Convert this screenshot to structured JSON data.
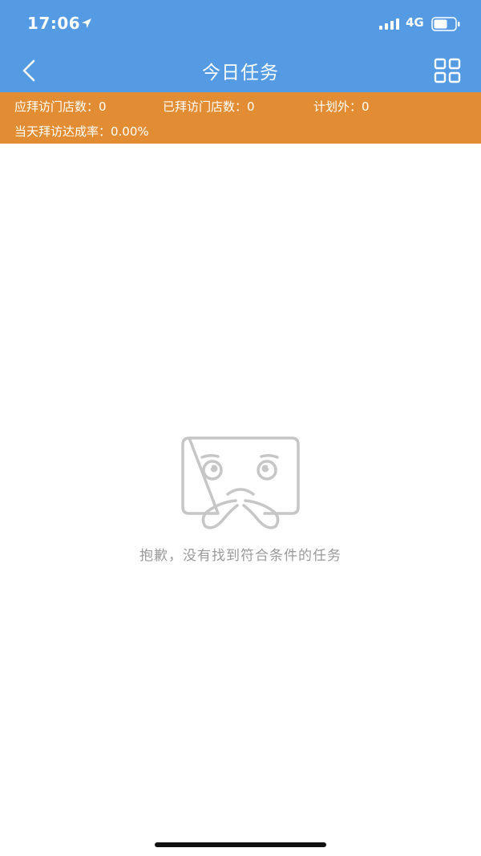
{
  "status_bar": {
    "time": "17:06",
    "network": "4G",
    "icons": [
      "location-arrow-icon",
      "signal-icon",
      "battery-icon"
    ]
  },
  "nav": {
    "title": "今日任务",
    "back_icon": "chevron-left-icon",
    "menu_icon": "grid-icon"
  },
  "stats": {
    "should_visit_label": "应拜访门店数：0",
    "visited_label": "已拜访门店数：0",
    "unplanned_label": "计划外：0",
    "rate_label": "当天拜访达成率：0.00%"
  },
  "empty_state": {
    "icon": "sad-face-icon",
    "message": "抱歉，没有找到符合条件的任务"
  },
  "colors": {
    "header_bg": "#559be3",
    "stats_bg": "#e28d33",
    "empty_text": "#9a9a9a"
  }
}
